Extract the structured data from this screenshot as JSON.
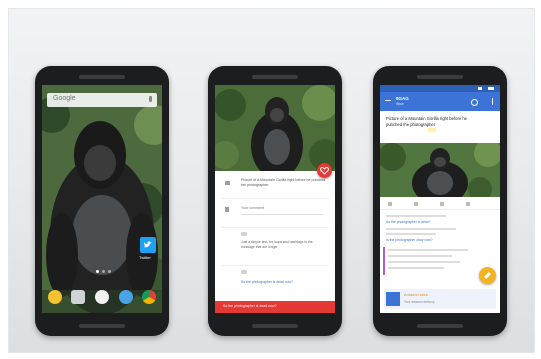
{
  "phone1": {
    "search_label": "Google",
    "dock_icons": [
      "app-icon",
      "camera-icon",
      "app-drawer-icon",
      "phone-icon",
      "chrome-icon"
    ],
    "twitter_label": "Twitter"
  },
  "phone2": {
    "tweet_text": "Picture of a Mountain Gorilla right before he punched the photographer.",
    "comment_label": "Your comment",
    "reply_text": "Just a simple test, for loops and hashtags in the message that are longer",
    "reply_text2": "So the photographer is dead now?",
    "input_placeholder": "So the photographer is dead now?"
  },
  "phone3": {
    "toolbar_title": "9GAG",
    "toolbar_subtitle": "Wow",
    "post_title": "Picture of a Mountain Gorilla right before he punched the photographer",
    "reply_placeholder": "So the photographer is dead?",
    "reply_link": "So the photographer is dead?",
    "reply_link2": "Is the photographer okay now?",
    "promo_title": "Amazon stick",
    "promo_sub": "Your amazon delivery"
  },
  "colors": {
    "accent_red": "#e53935",
    "accent_blue": "#3b74d6",
    "fab_amber": "#f6b320",
    "twitter_blue": "#1da1f2"
  }
}
